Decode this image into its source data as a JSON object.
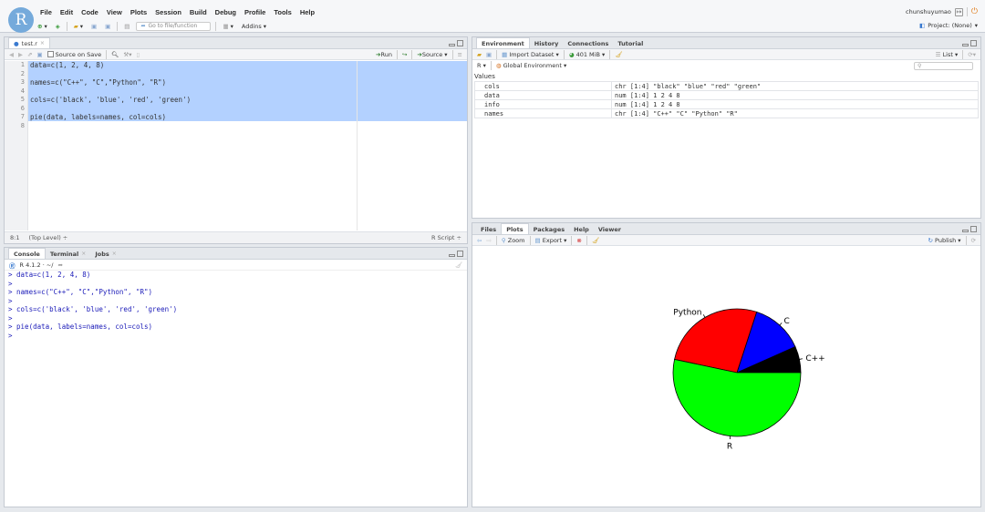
{
  "menu": [
    "File",
    "Edit",
    "Code",
    "View",
    "Plots",
    "Session",
    "Build",
    "Debug",
    "Profile",
    "Tools",
    "Help"
  ],
  "toolbar": {
    "goto_placeholder": "Go to file/function",
    "addins": "Addins"
  },
  "user": {
    "name": "chunshuyumao",
    "project": "Project: (None)"
  },
  "editor": {
    "tab": "test.r",
    "source_on_save": "Source on Save",
    "run": "Run",
    "source": "Source",
    "lines": [
      "data=c(1, 2, 4, 8)",
      "",
      "names=c(\"C++\", \"C\",\"Python\", \"R\")",
      "",
      "cols=c('black', 'blue', 'red', 'green')",
      "",
      "pie(data, labels=names, col=cols)",
      ""
    ],
    "line_numbers": [
      "1",
      "2",
      "3",
      "4",
      "5",
      "6",
      "7",
      "8"
    ],
    "status_pos": "8:1",
    "status_scope": "(Top Level) ÷",
    "status_type": "R Script ÷"
  },
  "console": {
    "tabs": [
      "Console",
      "Terminal",
      "Jobs"
    ],
    "r_version": "R 4.1.2 · ~/",
    "lines": [
      "> data=c(1, 2, 4, 8)",
      ">",
      "> names=c(\"C++\", \"C\",\"Python\", \"R\")",
      ">",
      "> cols=c('black', 'blue', 'red', 'green')",
      ">",
      "> pie(data, labels=names, col=cols)",
      "> "
    ]
  },
  "environment": {
    "tabs": [
      "Environment",
      "History",
      "Connections",
      "Tutorial"
    ],
    "import": "Import Dataset",
    "memory": "401 MiB",
    "list": "List",
    "r_sel": "R",
    "global": "Global Environment",
    "values_label": "Values",
    "rows": [
      {
        "name": "cols",
        "value": "chr [1:4] \"black\" \"blue\" \"red\" \"green\""
      },
      {
        "name": "data",
        "value": "num [1:4] 1 2 4 8"
      },
      {
        "name": "info",
        "value": "num [1:4] 1 2 4 8"
      },
      {
        "name": "names",
        "value": "chr [1:4] \"C++\" \"C\" \"Python\" \"R\""
      }
    ]
  },
  "plots": {
    "tabs": [
      "Files",
      "Plots",
      "Packages",
      "Help",
      "Viewer"
    ],
    "zoom": "Zoom",
    "export": "Export",
    "publish": "Publish"
  },
  "chart_data": {
    "type": "pie",
    "categories": [
      "C++",
      "C",
      "Python",
      "R"
    ],
    "values": [
      1,
      2,
      4,
      8
    ],
    "colors": [
      "#000000",
      "#0000ff",
      "#ff0000",
      "#00ff00"
    ]
  }
}
